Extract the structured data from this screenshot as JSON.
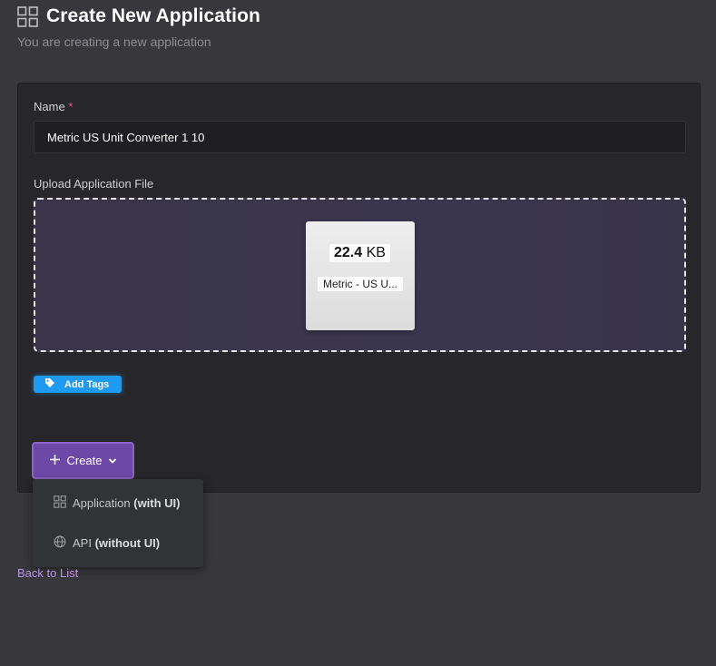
{
  "header": {
    "icon": "grid-icon",
    "title": "Create New Application",
    "subtitle": "You are creating a new application"
  },
  "form": {
    "name": {
      "label": "Name",
      "required_marker": "*",
      "value": "Metric US Unit Converter 1 10"
    },
    "upload": {
      "label": "Upload Application File",
      "file": {
        "size_value": "22.4",
        "size_unit": "KB",
        "name": "Metric - US U..."
      }
    },
    "tags_button": {
      "icon": "tag-icon",
      "label": "Add Tags"
    },
    "create_button": {
      "icon": "plus-icon",
      "label": "Create",
      "caret_icon": "chevron-down-icon"
    }
  },
  "create_menu": {
    "items": [
      {
        "icon": "grid-icon",
        "label": "Application",
        "qualifier": "(with UI)"
      },
      {
        "icon": "globe-icon",
        "label": "API",
        "qualifier": "(without UI)"
      }
    ]
  },
  "footer": {
    "back_link": "Back to List"
  },
  "colors": {
    "page_bg": "#37373c",
    "card_bg": "#27272b",
    "accent_purple": "#6e48a6",
    "tag_blue": "#1e9af0",
    "required_pink": "#e8548a",
    "link_purple": "#b896e4"
  }
}
